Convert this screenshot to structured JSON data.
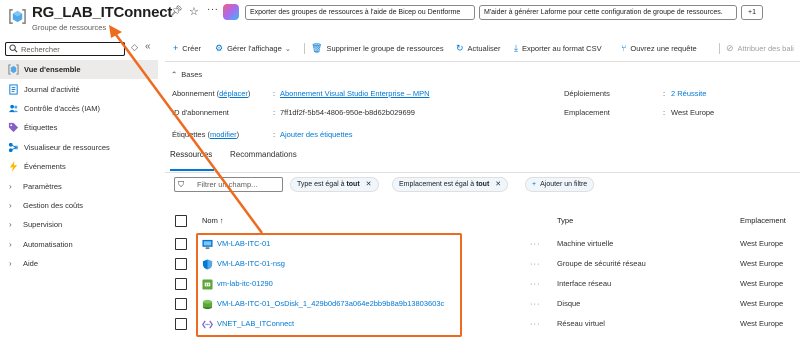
{
  "header": {
    "title": "RG_LAB_ITConnect",
    "subtitle": "Groupe de ressources",
    "actions": [
      "Exporter des groupes de ressources à l'aide de Bicep ou Dentforme",
      "M'aider à générer Laforme pour cette configuration de groupe de ressources.",
      "+1"
    ],
    "more": "···"
  },
  "sidebar": {
    "search_placeholder": "Rechercher",
    "collapse": "«",
    "items": [
      {
        "label": "Vue d'ensemble",
        "icon": "resource-group-icon"
      },
      {
        "label": "Journal d'activité",
        "icon": "activity-log-icon"
      },
      {
        "label": "Contrôle d'accès (IAM)",
        "icon": "people-icon"
      },
      {
        "label": "Étiquettes",
        "icon": "tag-icon"
      },
      {
        "label": "Visualiseur de ressources",
        "icon": "visualizer-icon"
      },
      {
        "label": "Événements",
        "icon": "lightning-icon"
      },
      {
        "label": "Paramètres",
        "icon": "chevron-right-icon"
      },
      {
        "label": "Gestion des coûts",
        "icon": "chevron-right-icon"
      },
      {
        "label": "Supervision",
        "icon": "chevron-right-icon"
      },
      {
        "label": "Automatisation",
        "icon": "chevron-right-icon"
      },
      {
        "label": "Aide",
        "icon": "chevron-right-icon"
      }
    ]
  },
  "toolbar": {
    "create": "Créer",
    "manage_view": "Gérer l'affichage",
    "delete_group": "Supprimer le groupe de ressources",
    "refresh": "Actualiser",
    "export_csv": "Exporter au format CSV",
    "open_query": "Ouvrez une requête",
    "assign_tags": "Attribuer des bali"
  },
  "essentials": {
    "toggle": "Bases",
    "subscription_label": "Abonnement",
    "subscription_move_link": "déplacer",
    "subscription_value": "Abonnement Visual Studio Enterprise – MPN",
    "subscription_id_label": "ID d'abonnement",
    "subscription_id_value": "7ff1df2f-5b54-4806-950e-b8d62b029699",
    "tags_label": "Étiquettes",
    "tags_modify_link": "modifier",
    "tags_value": "Ajouter des étiquettes",
    "deployments_label": "Déploiements",
    "deployments_value": "2 Réussite",
    "location_label": "Emplacement",
    "location_value": "West Europe",
    "sep": ":"
  },
  "tabs": {
    "resources": "Ressources",
    "recommendations": "Recommandations"
  },
  "filters": {
    "placeholder": "Filtrer un champ...",
    "chip_type_prefix": "Type est égal à",
    "chip_type_value": "tout",
    "chip_location_prefix": "Emplacement est égal à",
    "chip_location_value": "tout",
    "add_filter": "Ajouter un filtre",
    "remove": "✕"
  },
  "table": {
    "columns": {
      "name": "Nom ↑",
      "type": "Type",
      "location": "Emplacement"
    },
    "rows": [
      {
        "name": "VM-LAB-ITC-01",
        "type": "Machine virtuelle",
        "location": "West Europe",
        "icon": "virtual-machine-icon"
      },
      {
        "name": "VM-LAB-ITC-01-nsg",
        "type": "Groupe de sécurité réseau",
        "location": "West Europe",
        "icon": "shield-icon"
      },
      {
        "name": "vm-lab-itc-01290",
        "type": "Interface réseau",
        "location": "West Europe",
        "icon": "network-interface-icon"
      },
      {
        "name": "VM-LAB-ITC-01_OsDisk_1_429b0d673a064e2bb9b8a9b13803603c",
        "type": "Disque",
        "location": "West Europe",
        "icon": "disk-icon"
      },
      {
        "name": "VNET_LAB_ITConnect",
        "type": "Réseau virtuel",
        "location": "West Europe",
        "icon": "virtual-network-icon"
      }
    ],
    "row_menu": "···"
  },
  "annotation": {
    "color": "#ee6a1f"
  },
  "colors": {
    "accent": "#0078d4",
    "selected_bg": "#edebe9",
    "annotation": "#ee6a1f"
  }
}
